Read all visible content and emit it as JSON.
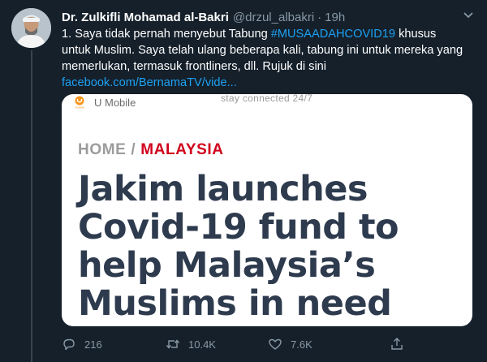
{
  "tweet": {
    "author_name": "Dr. Zulkifli Mohamad al-Bakri",
    "handle": "@drzul_albakri",
    "separator": "·",
    "time": "19h",
    "text_part1": "1. Saya tidak pernah menyebut Tabung ",
    "hashtag": "#MUSAADAHCOVID19",
    "text_part2": " khusus untuk Muslim. Saya telah ulang beberapa kali, tabung ini untuk mereka yang memerlukan, termasuk frontliners, dll. Rujuk di sini",
    "link": "facebook.com/BernamaTV/vide..."
  },
  "card": {
    "carrier": "U Mobile",
    "carrier_badge": "mobile",
    "status_text": "stay connected 24/7",
    "breadcrumb_home": "HOME",
    "breadcrumb_sep": "/",
    "breadcrumb_country": "MALAYSIA",
    "headline": "Jakim launches Covid-19 fund to help Malaysia’s Muslims in need"
  },
  "actions": {
    "reply_count": "216",
    "retweet_count": "10.4K",
    "like_count": "7.6K",
    "icons": [
      "reply-icon",
      "retweet-icon",
      "like-icon",
      "share-icon"
    ]
  },
  "colors": {
    "background": "#15202b",
    "link": "#1da1f2",
    "muted": "#8899a6",
    "breadcrumb_red": "#d0021b",
    "headline": "#2e3b4e"
  }
}
